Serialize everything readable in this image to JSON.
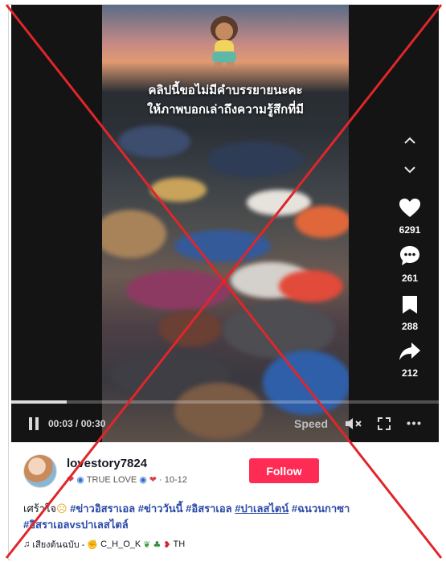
{
  "video": {
    "overlay_line1": "คลิปนี้ขอไม่มีคำบรรยายนะคะ",
    "overlay_line2": "ให้ภาพบอกเล่าถึงความรู้สึกที่มี"
  },
  "actions": {
    "likes": "6291",
    "comments": "261",
    "saves": "288",
    "shares": "212"
  },
  "controls": {
    "time": "00:03 / 00:30",
    "speed": "Speed",
    "progress_fraction": 0.13
  },
  "author": {
    "username": "lovestory7824",
    "display_name": "TRUE LOVE",
    "date": "· 10-12"
  },
  "follow_label": "Follow",
  "caption": {
    "prefix": "เศร้าใจ",
    "tags": [
      "#ข่าวอิสราเอล",
      "#ข่าววันนี้",
      "#อิสราเอล",
      "#ปาเลสไตน์",
      "#ฉนวนกาซา",
      "#อิสราเอลvsปาเลสไตล์"
    ]
  },
  "music": {
    "note": "♫",
    "text": "เสียงต้นฉบับ -",
    "artist": "C_H_O_K",
    "suffix": "TH"
  },
  "icons": [
    "play-pause-icon",
    "volume-mute-icon",
    "fullscreen-icon",
    "more-icon",
    "heart-icon",
    "comment-icon",
    "bookmark-icon",
    "share-icon",
    "chevron-up-icon",
    "chevron-down-icon",
    "music-note-icon"
  ],
  "colors": {
    "follow": "#fe2c55",
    "hashtag": "#2b4aa8",
    "cross": "#e0262b"
  }
}
